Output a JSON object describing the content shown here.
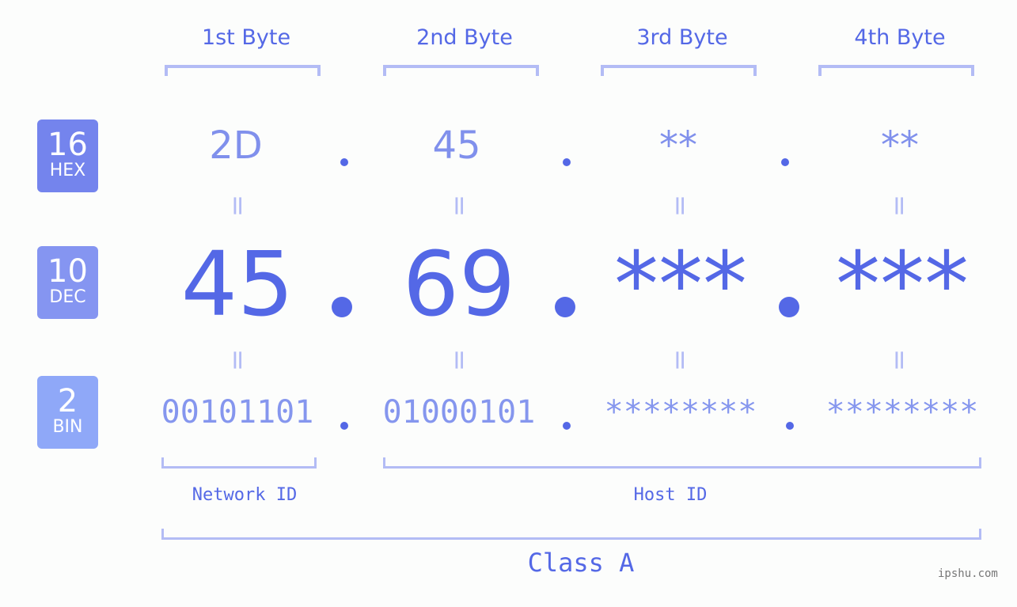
{
  "bases": [
    {
      "number": "16",
      "label": "HEX",
      "color": "#7484ed"
    },
    {
      "number": "10",
      "label": "DEC",
      "color": "#8595f1"
    },
    {
      "number": "2",
      "label": "BIN",
      "color": "#8fa8f8"
    }
  ],
  "byte_headers": [
    "1st Byte",
    "2nd Byte",
    "3rd Byte",
    "4th Byte"
  ],
  "hex": [
    "2D",
    "45",
    "**",
    "**"
  ],
  "dec": [
    "45",
    "69",
    "***",
    "***"
  ],
  "bin": [
    "00101101",
    "01000101",
    "********",
    "********"
  ],
  "equals_sign": "=",
  "dot_separator": ".",
  "network_label": "Network ID",
  "host_label": "Host ID",
  "class_label": "Class A",
  "watermark": "ipshu.com",
  "colors": {
    "accent": "#5468e6",
    "bracket": "#b3bcf5",
    "hex_text": "#8090ec",
    "bin_text": "#8596ee"
  }
}
